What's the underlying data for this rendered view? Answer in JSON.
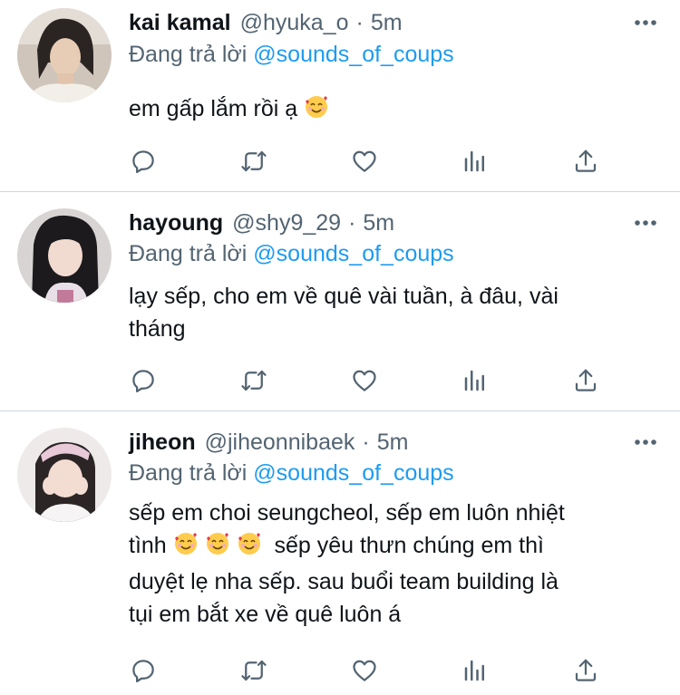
{
  "tweets": [
    {
      "name": "kai kamal",
      "handle": "@hyuka_o",
      "separator": "·",
      "time": "5m",
      "reply_prefix": "Đang trả lời",
      "reply_to": "@sounds_of_coups",
      "text_lines": [
        "em gấp lắm rồi ạ"
      ],
      "emoji": "smiling-face-with-hearts"
    },
    {
      "name": "hayoung",
      "handle": "@shy9_29",
      "separator": "·",
      "time": "5m",
      "reply_prefix": "Đang trả lời",
      "reply_to": "@sounds_of_coups",
      "text_lines": [
        "lạy sếp, cho em về quê vài tuần, à đâu, vài",
        "tháng"
      ]
    },
    {
      "name": "jiheon",
      "handle": "@jiheonnibaek",
      "separator": "·",
      "time": "5m",
      "reply_prefix": "Đang trả lời",
      "reply_to": "@sounds_of_coups",
      "text_lines": [
        "sếp em choi seungcheol, sếp em luôn nhiệt",
        "tình",
        "sếp yêu thưn chúng em thì",
        "duyệt lẹ nha sếp. sau buổi team building là",
        "tụi em bắt xe về quê luôn á"
      ],
      "emoji": "smiling-face-with-hearts"
    }
  ],
  "action_icons": [
    "reply-icon",
    "retweet-icon",
    "like-icon",
    "analytics-icon",
    "share-icon"
  ],
  "colors": {
    "text": "#0f1419",
    "secondary": "#536471",
    "mention": "#1d9bf0",
    "divider": "#cfd9de"
  }
}
